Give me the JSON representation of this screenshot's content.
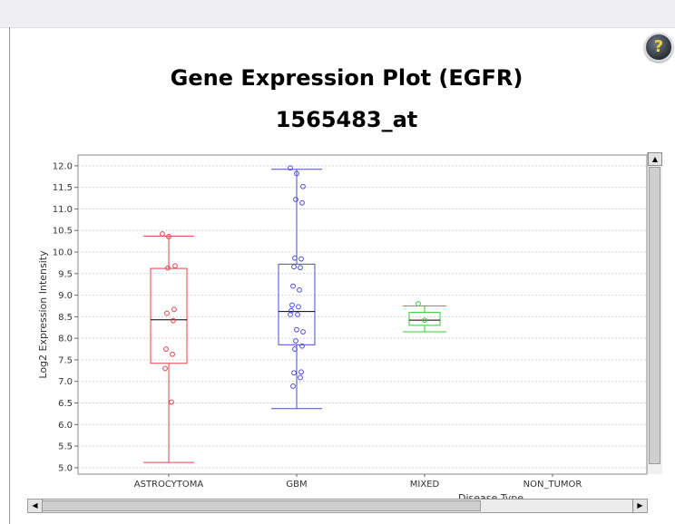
{
  "chart_data": {
    "type": "box",
    "title": "Gene Expression Plot (EGFR)",
    "subtitle": "1565483_at",
    "xlabel": "Disease Type",
    "ylabel": "Log2 Expression Intensity",
    "categories": [
      "ASTROCYTOMA",
      "GBM",
      "MIXED",
      "NON_TUMOR"
    ],
    "ylim": [
      4.85,
      12.25
    ],
    "yticks": [
      "5.0",
      "5.5",
      "6.0",
      "6.5",
      "7.0",
      "7.5",
      "8.0",
      "8.5",
      "9.0",
      "9.5",
      "10.0",
      "10.5",
      "11.0",
      "11.5",
      "12.0"
    ],
    "grid": true,
    "colors": {
      "ASTROCYTOMA": "#e0444b",
      "GBM": "#4b4bd6",
      "MIXED": "#2fcf2f"
    },
    "boxes": [
      {
        "category": "ASTROCYTOMA",
        "min": 5.12,
        "q1": 7.42,
        "median": 8.43,
        "q3": 9.62,
        "max": 10.37,
        "points": [
          10.42,
          10.36,
          9.68,
          9.63,
          8.67,
          8.58,
          8.41,
          7.75,
          7.63,
          7.3,
          6.52
        ]
      },
      {
        "category": "GBM",
        "min": 6.37,
        "q1": 7.85,
        "median": 8.62,
        "q3": 9.72,
        "max": 11.92,
        "points": [
          11.95,
          11.82,
          11.52,
          11.22,
          11.14,
          9.86,
          9.84,
          9.66,
          9.64,
          9.21,
          9.12,
          8.77,
          8.73,
          8.64,
          8.55,
          8.55,
          8.2,
          8.15,
          7.94,
          7.82,
          7.75,
          7.22,
          7.2,
          7.09,
          6.89
        ]
      },
      {
        "category": "MIXED",
        "min": 8.15,
        "q1": 8.3,
        "median": 8.42,
        "q3": 8.6,
        "max": 8.75,
        "points": [
          8.8,
          8.42
        ]
      }
    ]
  },
  "ui": {
    "help_label": "?",
    "scroll_up": "▲",
    "scroll_left": "◀",
    "scroll_right": "▶"
  }
}
